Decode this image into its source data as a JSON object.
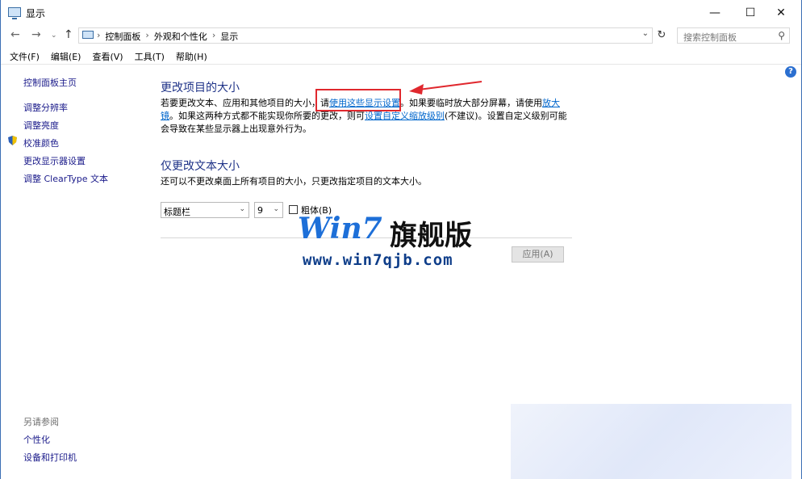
{
  "window": {
    "title": "显示"
  },
  "address": {
    "crumbs": [
      "控制面板",
      "外观和个性化",
      "显示"
    ],
    "search_placeholder": "搜索控制面板"
  },
  "menu": [
    "文件(F)",
    "编辑(E)",
    "查看(V)",
    "工具(T)",
    "帮助(H)"
  ],
  "sidebar": {
    "home": "控制面板主页",
    "links": [
      "调整分辨率",
      "调整亮度",
      "校准颜色",
      "更改显示器设置",
      "调整 ClearType 文本"
    ],
    "see_also_label": "另请参阅",
    "see_also": [
      "个性化",
      "设备和打印机"
    ]
  },
  "main": {
    "section1_title": "更改项目的大小",
    "p1_a": "若要更改文本、应用和其他项目的大小，请",
    "p1_link1": "使用这些显示设置",
    "p1_b": "。如果要临时放大部分屏幕，请使用",
    "p1_link2": "放大镜",
    "p1_c": "。如果这两种方式都不能实现你所要的更改，则可",
    "p1_link3": "设置自定义缩放级别",
    "p1_d": "(不建议)。设置自定义级别可能会导致在某些显示器上出现意外行为。",
    "section2_title": "仅更改文本大小",
    "p2": "还可以不更改桌面上所有项目的大小，只更改指定项目的文本大小。",
    "item_select": "标题栏",
    "size_select": "9",
    "bold_label": "粗体(B)",
    "apply_label": "应用(A)"
  },
  "watermark": {
    "title_a": "Win7",
    "title_b": "旗舰版",
    "url": "www.win7qjb.com"
  },
  "colors": {
    "accent_link": "#0066cc",
    "heading": "#1e3287",
    "highlight": "#e0282e"
  }
}
